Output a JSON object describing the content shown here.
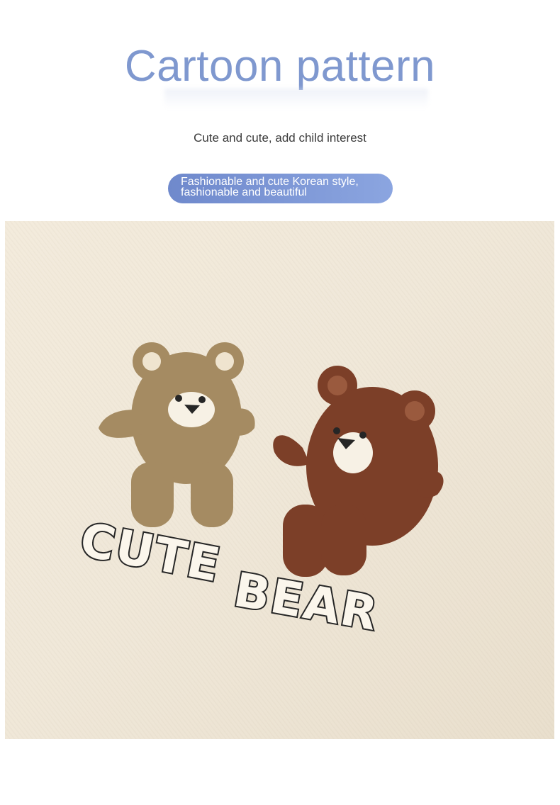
{
  "header": {
    "title": "Cartoon pattern",
    "subtitle": "Cute and cute, add child interest",
    "badge": "Fashionable and cute Korean style, fashionable and beautiful"
  },
  "photo": {
    "print_words": [
      "CUTE",
      "BEAR"
    ],
    "colors": {
      "fabric": "#f1e9da",
      "bear_left": "#a58b62",
      "bear_right": "#7c3f28",
      "face_patch": "#f7f1e5",
      "outline": "#262626"
    }
  },
  "colors": {
    "title": "#7f98cf",
    "pill": "#7b95d5",
    "subtitle": "#3a3a3a"
  }
}
